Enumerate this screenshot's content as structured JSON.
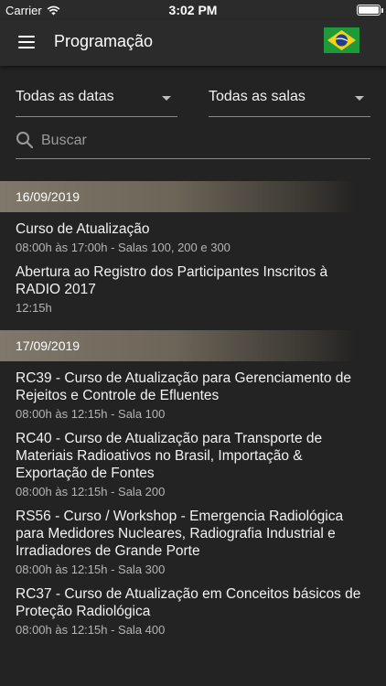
{
  "status_bar": {
    "carrier": "Carrier",
    "time": "3:02 PM"
  },
  "app_bar": {
    "title": "Programação",
    "menu_icon": "hamburger-menu-icon",
    "language_flag": "brazil-flag-icon"
  },
  "filters": {
    "date_filter": "Todas as datas",
    "room_filter": "Todas as salas",
    "search_placeholder": "Buscar",
    "search_value": ""
  },
  "schedule": [
    {
      "date": "16/09/2019",
      "events": [
        {
          "title": "Curso de Atualização",
          "meta": "08:00h às 17:00h - Salas 100, 200 e 300"
        },
        {
          "title": "Abertura ao Registro dos Participantes Inscritos à RADIO 2017",
          "meta": "12:15h"
        }
      ]
    },
    {
      "date": "17/09/2019",
      "events": [
        {
          "title": "RC39 - Curso de Atualização para Gerenciamento de Rejeitos e Controle de Efluentes",
          "meta": "08:00h às 12:15h - Sala 100"
        },
        {
          "title": "RC40 - Curso de Atualização para Transporte de Materiais Radioativos no Brasil, Importação & Exportação de Fontes",
          "meta": "08:00h às 12:15h - Sala 200"
        },
        {
          "title": "RS56 - Curso / Workshop - Emergencia Radiológica para Medidores Nucleares, Radiografia Industrial e Irradiadores de Grande Porte",
          "meta": "08:00h às 12:15h - Sala 300"
        },
        {
          "title": "RC37 - Curso de Atualização em Conceitos básicos de Proteção Radiológica",
          "meta": "08:00h às 12:15h - Sala 400"
        }
      ]
    }
  ],
  "colors": {
    "background": "#232323",
    "app_bar": "#2b2b2b",
    "date_header": "#80786a",
    "text_primary": "#f2f2f2",
    "text_secondary": "#b5b5b5"
  }
}
